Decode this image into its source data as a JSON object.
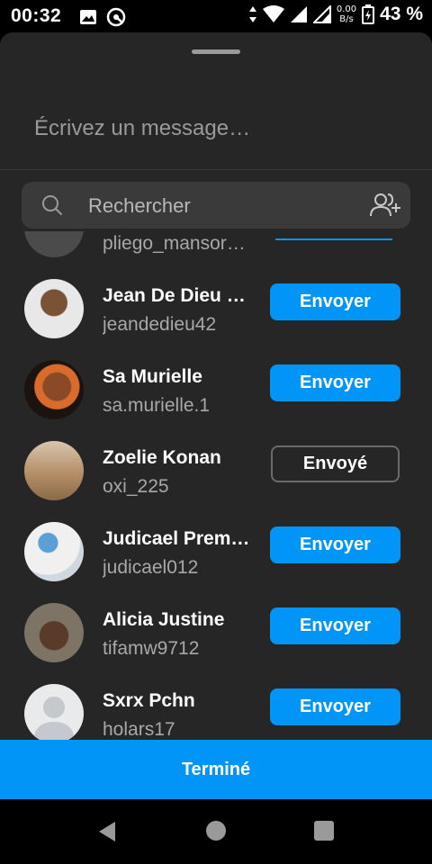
{
  "status_bar": {
    "time": "00:32",
    "net_speed_value": "0.00",
    "net_speed_unit": "B/s",
    "battery": "43 %"
  },
  "composer": {
    "placeholder": "Écrivez un message…"
  },
  "search": {
    "placeholder": "Rechercher"
  },
  "contacts": [
    {
      "name": "",
      "username": "pliego_mansor…",
      "button": "",
      "state": "partial"
    },
    {
      "name": "Jean De Dieu …",
      "username": "jeandedieu42",
      "button": "Envoyer",
      "state": "send"
    },
    {
      "name": "Sa Murielle",
      "username": "sa.murielle.1",
      "button": "Envoyer",
      "state": "send"
    },
    {
      "name": "Zoelie Konan",
      "username": "oxi_225",
      "button": "Envoyé",
      "state": "sent"
    },
    {
      "name": "Judicael Prem…",
      "username": "judicael012",
      "button": "Envoyer",
      "state": "send"
    },
    {
      "name": "Alicia Justine",
      "username": "tifamw9712",
      "button": "Envoyer",
      "state": "send"
    },
    {
      "name": "Sxrx Pchn",
      "username": "holars17",
      "button": "Envoyer",
      "state": "send"
    }
  ],
  "done_button": "Terminé",
  "colors": {
    "accent": "#0095f6",
    "sheet_background": "#262626",
    "search_background": "#3a3a3a"
  },
  "icons": [
    "gallery-icon",
    "vpn-key-icon",
    "silent-icon",
    "wifi-icon",
    "signal-icon",
    "battery-charging-icon",
    "search-icon",
    "add-people-icon",
    "back-icon",
    "home-icon",
    "recents-icon"
  ]
}
